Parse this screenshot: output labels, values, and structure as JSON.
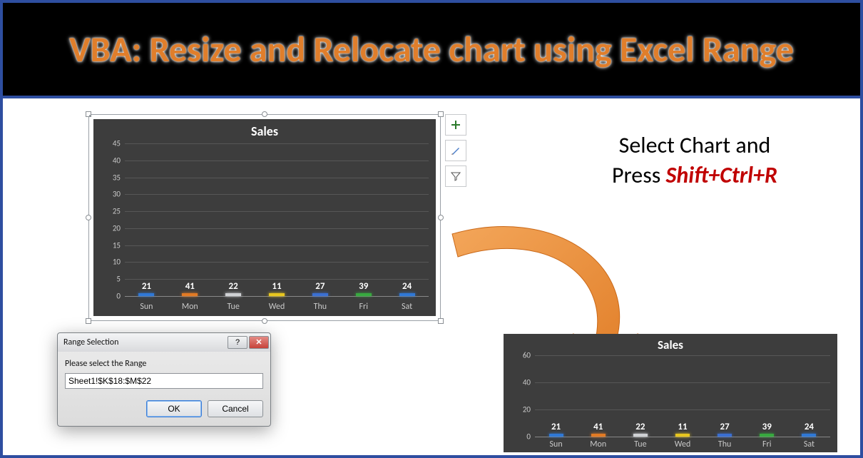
{
  "title": "VBA: Resize and Relocate chart using Excel Range",
  "instruction": {
    "line1": "Select Chart and",
    "line2": "Press ",
    "shortcut": "Shift+Ctrl+R"
  },
  "actions": {
    "add": "+",
    "style": "brush",
    "filter": "funnel"
  },
  "dialog": {
    "title": "Range Selection",
    "prompt": "Please select the Range",
    "value": "Sheet1!$K$18:$M$22",
    "ok": "OK",
    "cancel": "Cancel"
  },
  "chart_data": [
    {
      "type": "bar",
      "title": "Sales",
      "categories": [
        "Sun",
        "Mon",
        "Tue",
        "Wed",
        "Thu",
        "Fri",
        "Sat"
      ],
      "values": [
        21,
        41,
        22,
        11,
        27,
        39,
        24
      ],
      "colors": [
        "#2f78d6",
        "#e27a24",
        "#cfd1d4",
        "#e7c61f",
        "#3a6fd2",
        "#37a93f",
        "#2f78d6"
      ],
      "ylim": [
        0,
        45
      ],
      "yticks": [
        0,
        5,
        10,
        15,
        20,
        25,
        30,
        35,
        40,
        45
      ],
      "selected": true
    },
    {
      "type": "bar",
      "title": "Sales",
      "categories": [
        "Sun",
        "Mon",
        "Tue",
        "Wed",
        "Thu",
        "Fri",
        "Sat"
      ],
      "values": [
        21,
        41,
        22,
        11,
        27,
        39,
        24
      ],
      "colors": [
        "#2f78d6",
        "#e27a24",
        "#cfd1d4",
        "#e7c61f",
        "#3a6fd2",
        "#37a93f",
        "#2f78d6"
      ],
      "ylim": [
        0,
        60
      ],
      "yticks": [
        0,
        20,
        40,
        60
      ]
    }
  ]
}
